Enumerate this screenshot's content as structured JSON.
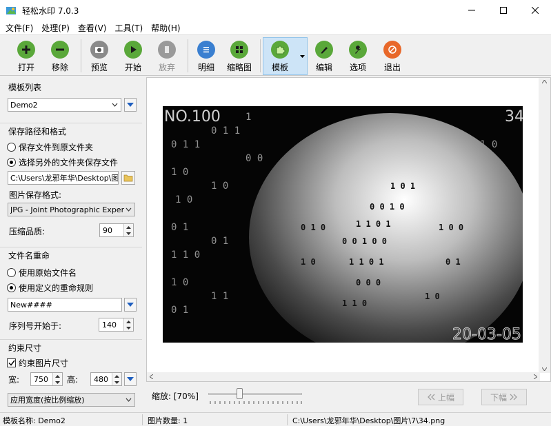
{
  "window": {
    "title": "轻松水印 7.0.3"
  },
  "menu": [
    "文件(F)",
    "处理(P)",
    "查看(V)",
    "工具(T)",
    "帮助(H)"
  ],
  "toolbar": {
    "open": "打开",
    "remove": "移除",
    "preview": "预览",
    "start": "开始",
    "abort": "放弃",
    "detail": "明细",
    "thumbnail": "缩略图",
    "template": "模板",
    "edit": "编辑",
    "options": "选项",
    "exit": "退出"
  },
  "colors": {
    "green": "#5aa83a",
    "blue": "#3a7fd0",
    "orange": "#e8682a",
    "gray": "#8a8a8a",
    "active": "#cde4f7"
  },
  "template_list": {
    "title": "模板列表",
    "selected": "Demo2"
  },
  "save": {
    "title": "保存路径和格式",
    "option_original": "保存文件到原文件夹",
    "option_other": "选择另外的文件夹保存文件",
    "path": "C:\\Users\\龙邪年华\\Desktop\\图片",
    "format_label": "图片保存格式:",
    "format_value": "JPG - Joint Photographic Experts Group",
    "quality_label": "压缩品质:",
    "quality_value": "90"
  },
  "rename": {
    "title": "文件名重命",
    "option_original": "使用原始文件名",
    "option_custom": "使用定义的重命规则",
    "pattern": "New####",
    "seq_label": "序列号开始于:",
    "seq_value": "140"
  },
  "constrain": {
    "title": "约束尺寸",
    "checkbox_label": "约束图片尺寸",
    "width_label": "宽:",
    "width_value": "750",
    "height_label": "高:",
    "height_value": "480",
    "mode_value": "应用宽度(按比例缩放)"
  },
  "preview": {
    "wm_top_left": "NO.100",
    "wm_top_right": "34",
    "wm_bottom_right": "20-03-05"
  },
  "zoom": {
    "label": "缩放: [70%]",
    "level_percent": 70,
    "prev": "上幅",
    "next": "下幅"
  },
  "status": {
    "template_name": "模板名称:  Demo2",
    "image_count": "图片数量:   1",
    "file_path": "C:\\Users\\龙邪年华\\Desktop\\图片\\7\\34.png"
  }
}
